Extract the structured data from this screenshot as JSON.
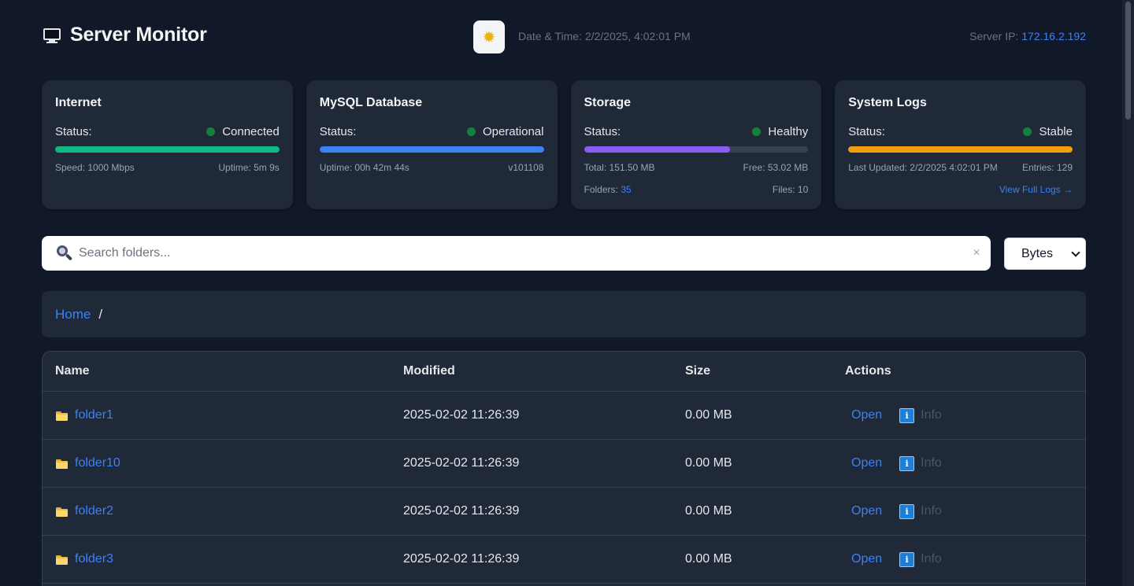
{
  "header": {
    "title": "Server Monitor",
    "theme_icon": "sun-icon",
    "datetime_label": "Date & Time:",
    "datetime_value": "2/2/2025, 4:02:01 PM",
    "server_ip_label": "Server IP:",
    "server_ip_value": "172.16.2.192"
  },
  "cards": {
    "internet": {
      "title": "Internet",
      "status_label": "Status:",
      "status": "Connected",
      "progress": 1.0,
      "color": "#10b981",
      "speed": "Speed: 1000 Mbps",
      "uptime": "Uptime: 5m 9s"
    },
    "mysql": {
      "title": "MySQL Database",
      "status_label": "Status:",
      "status": "Operational",
      "progress": 1.0,
      "color": "#3b82f6",
      "uptime": "Uptime: 00h 42m 44s",
      "version": "v101108"
    },
    "storage": {
      "title": "Storage",
      "status_label": "Status:",
      "status": "Healthy",
      "progress": 0.65,
      "color": "#8b5cf6",
      "total": "Total: 151.50 MB",
      "free": "Free: 53.02 MB",
      "folders_label": "Folders:",
      "folders_value": "35",
      "files": "Files: 10"
    },
    "logs": {
      "title": "System Logs",
      "status_label": "Status:",
      "status": "Stable",
      "progress": 1.0,
      "color": "#f59e0b",
      "last_updated": "Last Updated: 2/2/2025 4:02:01 PM",
      "entries": "Entries: 129",
      "view_logs": "View Full Logs →"
    }
  },
  "search": {
    "placeholder": "Search folders...",
    "value": "",
    "clear": "×"
  },
  "unit_select": {
    "selected": "Bytes"
  },
  "breadcrumb": {
    "home": "Home",
    "separator": "/"
  },
  "table": {
    "headers": {
      "name": "Name",
      "modified": "Modified",
      "size": "Size",
      "actions": "Actions"
    },
    "open_label": "Open",
    "info_label": "Info",
    "rows": [
      {
        "name": "folder1",
        "modified": "2025-02-02 11:26:39",
        "size": "0.00 MB"
      },
      {
        "name": "folder10",
        "modified": "2025-02-02 11:26:39",
        "size": "0.00 MB"
      },
      {
        "name": "folder2",
        "modified": "2025-02-02 11:26:39",
        "size": "0.00 MB"
      },
      {
        "name": "folder3",
        "modified": "2025-02-02 11:26:39",
        "size": "0.00 MB"
      }
    ]
  }
}
